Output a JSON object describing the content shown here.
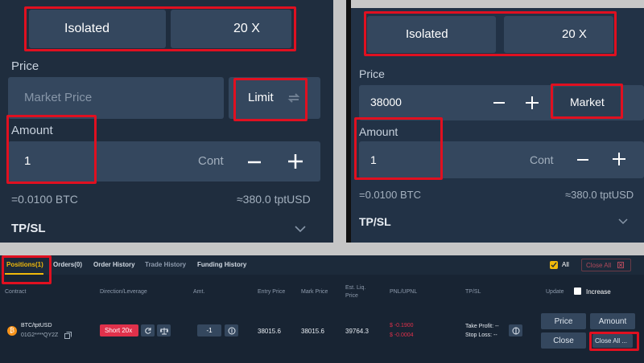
{
  "left": {
    "margin_mode": "Isolated",
    "leverage": "20 X",
    "price_label": "Price",
    "price_placeholder": "Market Price",
    "price_type": "Limit",
    "amount_label": "Amount",
    "amount_value": "1",
    "amount_unit": "Cont",
    "btc_value": "=0.0100 BTC",
    "usd_value": "≈380.0 tptUSD",
    "tpsl": "TP/SL"
  },
  "right": {
    "margin_mode": "Isolated",
    "leverage": "20 X",
    "price_label": "Price",
    "price_value": "38000",
    "price_type": "Market",
    "amount_label": "Amount",
    "amount_value": "1",
    "amount_unit": "Cont",
    "btc_value": "=0.0100 BTC",
    "usd_value": "≈380.0 tptUSD",
    "tpsl": "TP/SL"
  },
  "tabs": {
    "positions": "Positions(1)",
    "orders": "Orders(0)",
    "order_history": "Order History",
    "trade_history": "Trade History",
    "funding_history": "Funding History",
    "all": "All",
    "close_all": "Close All"
  },
  "columns": {
    "contract": "Contract",
    "direction": "Direction/Leverage",
    "amt": "Amt.",
    "entry": "Entry Price",
    "mark": "Mark Price",
    "liq_1": "Est. Liq.",
    "liq_2": "Price",
    "pnl": "PNL/UPNL",
    "tpsl": "TP/SL",
    "update": "Update",
    "increase": "Increase"
  },
  "row": {
    "symbol": "BTC/tptUSD",
    "id": "01G2****QY2Z",
    "direction": "Short 20x",
    "amt": "-1",
    "entry": "38015.6",
    "mark": "38015.6",
    "liq": "39764.3",
    "pnl": "$ -0.1900",
    "upnl": "$ -0.0004",
    "take_profit": "Take Profit: --",
    "stop_loss": "Stop Loss: --",
    "price_btn": "Price",
    "amount_btn": "Amount",
    "close_btn": "Close",
    "close_all_btn": "Close All ..."
  },
  "colors": {
    "accent_red": "#e01020",
    "short_red": "#e0314b",
    "highlight_yellow": "#f0b90b"
  }
}
